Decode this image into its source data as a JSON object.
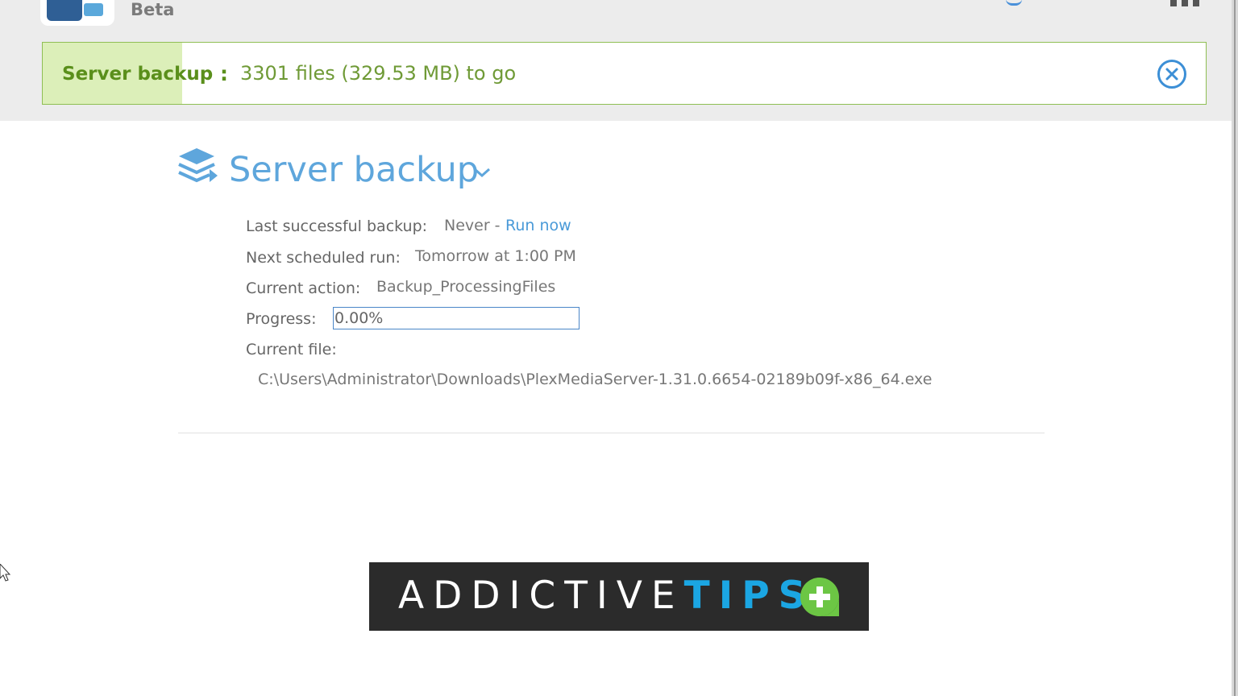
{
  "app": {
    "subtitle": "Beta"
  },
  "banner": {
    "title": "Server backup",
    "separator": ":",
    "status": "3301 files (329.53 MB) to go",
    "fill_fraction": 0.12,
    "colors": {
      "border": "#8fbf54",
      "fill": "#dcefb9",
      "text": "#5a8f1b",
      "close": "#3c8fd6"
    },
    "close_icon": "close-circle-icon"
  },
  "section": {
    "title": "Server backup",
    "icon": "stacked-layers-icon",
    "chevron_icon": "chevron-down-icon",
    "accent": "#5ea6dc"
  },
  "details": {
    "last_backup_label": "Last successful backup:",
    "last_backup_value": "Never -",
    "run_now_link": "Run now",
    "next_run_label": "Next scheduled run:",
    "next_run_value": "Tomorrow at 1:00 PM",
    "current_action_label": "Current action:",
    "current_action_value": "Backup_ProcessingFiles",
    "progress_label": "Progress:",
    "progress_text": "0.00%",
    "progress_fraction": 0.0,
    "current_file_label": "Current file:",
    "current_file_value": "C:\\Users\\Administrator\\Downloads\\PlexMediaServer-1.31.0.6654-02189b09f-x86_64.exe"
  },
  "watermark": {
    "part1": "ADDICTIVE",
    "part2": "TIPS",
    "plus_icon": "plus-badge-icon",
    "colors": {
      "bg": "#2b2b2b",
      "blue": "#1ba6e3",
      "green": "#6cc644"
    }
  }
}
